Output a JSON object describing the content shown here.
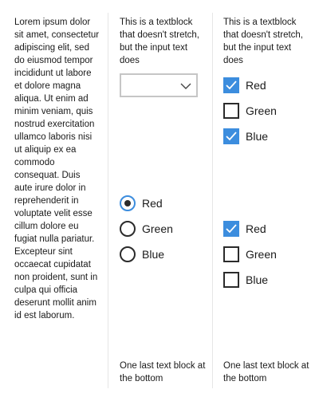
{
  "col1": {
    "lorem": "Lorem ipsum dolor sit amet, consectetur adipiscing elit, sed do eiusmod tempor incididunt ut labore et dolore magna aliqua. Ut enim ad minim veniam, quis nostrud exercitation ullamco laboris nisi ut aliquip ex ea commodo consequat. Duis aute irure dolor in reprehenderit in voluptate velit esse cillum dolore eu fugiat nulla pariatur. Excepteur sint occaecat cupidatat non proident, sunt in culpa qui officia deserunt mollit anim id est laborum."
  },
  "col2": {
    "intro": "This is a textblock that doesn't stretch, but the input text does",
    "combo": {
      "value": "",
      "icon": "chevron-down-icon"
    },
    "radios": [
      {
        "label": "Red",
        "selected": true
      },
      {
        "label": "Green",
        "selected": false
      },
      {
        "label": "Blue",
        "selected": false
      }
    ],
    "footer": "One last text block at the bottom"
  },
  "col3": {
    "intro": "This is a textblock that doesn't stretch, but the input text does",
    "checks_top": [
      {
        "label": "Red",
        "checked": true
      },
      {
        "label": "Green",
        "checked": false
      },
      {
        "label": "Blue",
        "checked": true
      }
    ],
    "checks_bottom": [
      {
        "label": "Red",
        "checked": true
      },
      {
        "label": "Green",
        "checked": false
      },
      {
        "label": "Blue",
        "checked": false
      }
    ],
    "footer": "One last text block at the bottom"
  },
  "colors": {
    "accent": "#3c8dde",
    "divider": "#e6e6e6",
    "border": "#c6c6c6"
  }
}
